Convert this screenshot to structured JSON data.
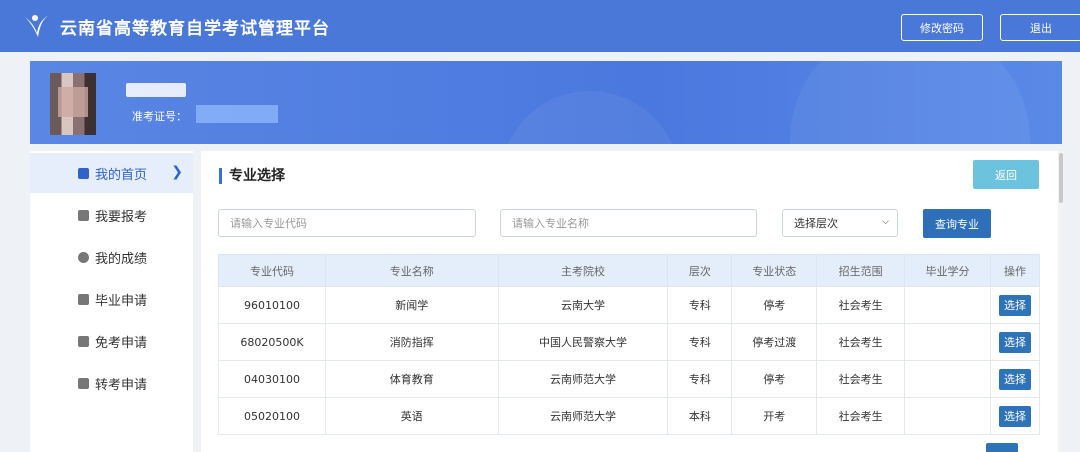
{
  "header": {
    "title": "云南省高等教育自学考试管理平台",
    "change_password": "修改密码",
    "logout": "退出"
  },
  "profile": {
    "ticket_label": "准考证号："
  },
  "sidebar": {
    "items": [
      {
        "label": "我的首页",
        "icon": "home-icon"
      },
      {
        "label": "我要报考",
        "icon": "register-icon"
      },
      {
        "label": "我的成绩",
        "icon": "score-icon"
      },
      {
        "label": "毕业申请",
        "icon": "graduation-icon"
      },
      {
        "label": "免考申请",
        "icon": "exemption-icon"
      },
      {
        "label": "转考申请",
        "icon": "transfer-icon"
      }
    ],
    "active_index": 0
  },
  "main": {
    "title": "专业选择",
    "back_label": "返回",
    "search": {
      "code_placeholder": "请输入专业代码",
      "name_placeholder": "请输入专业名称",
      "level_selected": "选择层次",
      "query_label": "查询专业"
    },
    "table": {
      "columns": [
        "专业代码",
        "专业名称",
        "主考院校",
        "层次",
        "专业状态",
        "招生范围",
        "毕业学分",
        "操作"
      ],
      "rows": [
        {
          "code": "96010100",
          "name": "新闻学",
          "school": "云南大学",
          "level": "专科",
          "status": "停考",
          "scope": "社会考生",
          "credits": "",
          "action": "选择"
        },
        {
          "code": "68020500K",
          "name": "消防指挥",
          "school": "中国人民警察大学",
          "level": "专科",
          "status": "停考过渡",
          "scope": "社会考生",
          "credits": "",
          "action": "选择"
        },
        {
          "code": "04030100",
          "name": "体育教育",
          "school": "云南师范大学",
          "level": "专科",
          "status": "停考",
          "scope": "社会考生",
          "credits": "",
          "action": "选择"
        },
        {
          "code": "05020100",
          "name": "英语",
          "school": "云南师范大学",
          "level": "本科",
          "status": "开考",
          "scope": "社会考生",
          "credits": "",
          "action": "选择"
        }
      ]
    }
  },
  "colors": {
    "header_bg": "#4a78d8",
    "accent": "#2e72b8",
    "back_button": "#6cc3dd"
  }
}
